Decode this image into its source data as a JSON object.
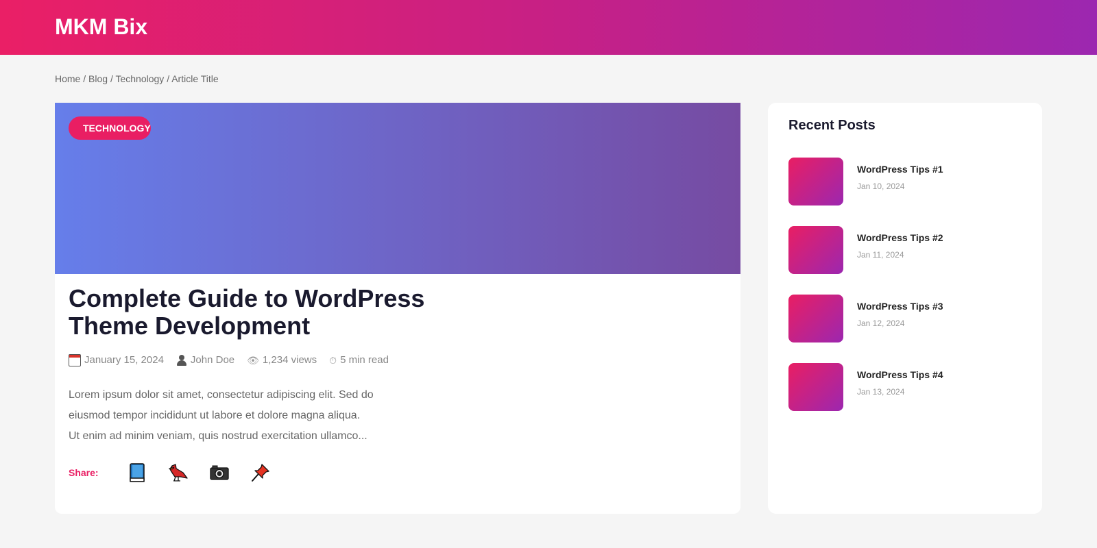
{
  "site": {
    "logo": "MKM Bix"
  },
  "breadcrumb": {
    "separator": " / ",
    "items": [
      "Home",
      "Blog",
      "Technology",
      "Article Title"
    ]
  },
  "article": {
    "category": "TECHNOLOGY",
    "title": "Complete Guide to WordPress Theme Development",
    "meta": {
      "date": "January 15, 2024",
      "author": "John Doe",
      "views": "1,234 views",
      "read_time": "5 min read",
      "icons": {
        "date": "calendar-icon",
        "author": "user-icon",
        "views": "eye-icon",
        "read_time": "clock-icon"
      }
    },
    "excerpt_lines": [
      "Lorem ipsum dolor sit amet, consectetur adipiscing elit. Sed do",
      "eiusmod tempor incididunt ut labore et dolore magna aliqua.",
      "Ut enim ad minim veniam, quis nostrud exercitation ullamco..."
    ],
    "share": {
      "label": "Share:",
      "buttons": [
        "book-icon",
        "bird-icon",
        "camera-icon",
        "pushpin-icon"
      ]
    }
  },
  "sidebar": {
    "title": "Recent Posts",
    "posts": [
      {
        "title": "WordPress Tips #1",
        "date": "Jan 10, 2024"
      },
      {
        "title": "WordPress Tips #2",
        "date": "Jan 11, 2024"
      },
      {
        "title": "WordPress Tips #3",
        "date": "Jan 12, 2024"
      },
      {
        "title": "WordPress Tips #4",
        "date": "Jan 13, 2024"
      }
    ]
  },
  "colors": {
    "brand_pink": "#e91e63",
    "brand_purple": "#9c27b0",
    "hero_start": "#667eea",
    "hero_end": "#764ba2",
    "page_bg": "#f5f5f5"
  }
}
